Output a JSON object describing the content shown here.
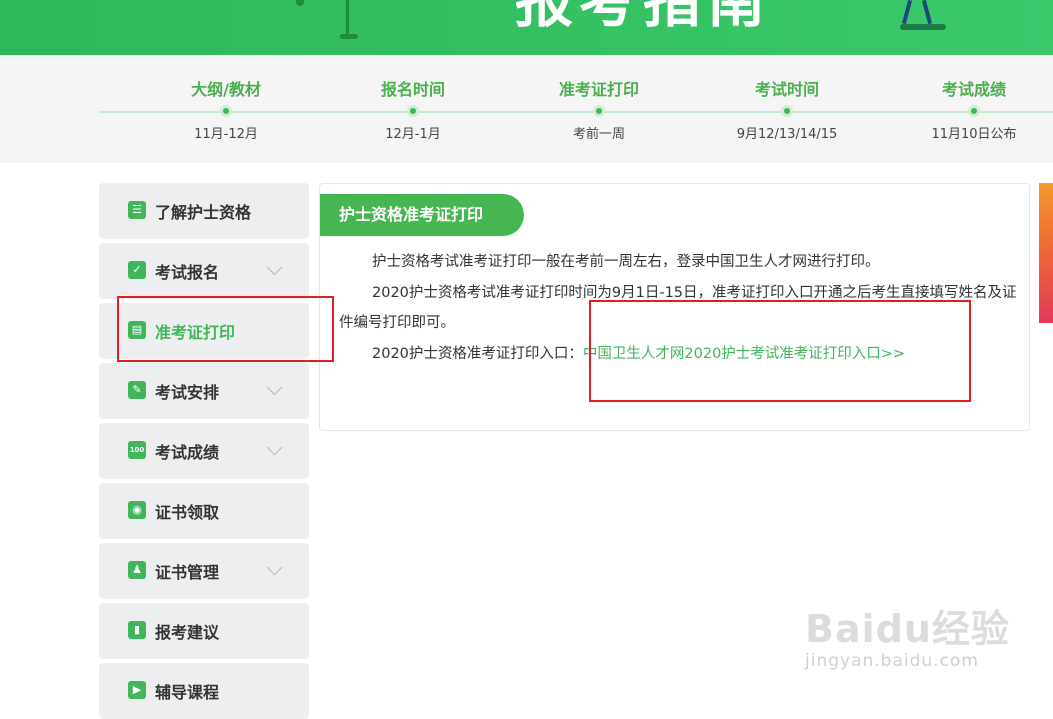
{
  "banner": {
    "title": "报考指南"
  },
  "timeline": [
    {
      "title": "大纲/教材",
      "sub": "11月-12月"
    },
    {
      "title": "报名时间",
      "sub": "12月-1月"
    },
    {
      "title": "准考证打印",
      "sub": "考前一周"
    },
    {
      "title": "考试时间",
      "sub": "9月12/13/14/15"
    },
    {
      "title": "考试成绩",
      "sub": "11月10日公布"
    }
  ],
  "sidebar": {
    "items": [
      {
        "label": "了解护士资格",
        "icon": "list-icon",
        "glyph": "☰",
        "expandable": false
      },
      {
        "label": "考试报名",
        "icon": "monitor-check-icon",
        "glyph": "✓",
        "expandable": true
      },
      {
        "label": "准考证打印",
        "icon": "id-card-icon",
        "glyph": "▤",
        "expandable": false,
        "active": true
      },
      {
        "label": "考试安排",
        "icon": "edit-icon",
        "glyph": "✎",
        "expandable": true
      },
      {
        "label": "考试成绩",
        "icon": "score-icon",
        "glyph": "100",
        "expandable": true
      },
      {
        "label": "证书领取",
        "icon": "medal-icon",
        "glyph": "◉",
        "expandable": false
      },
      {
        "label": "证书管理",
        "icon": "user-doc-icon",
        "glyph": "♟",
        "expandable": true
      },
      {
        "label": "报考建议",
        "icon": "bar-chart-icon",
        "glyph": "▮",
        "expandable": false
      },
      {
        "label": "辅导课程",
        "icon": "play-icon",
        "glyph": "▶",
        "expandable": false
      }
    ]
  },
  "content": {
    "tab_title": "护士资格准考证打印",
    "para1": "护士资格考试准考证打印一般在考前一周左右，登录中国卫生人才网进行打印。",
    "para2": "2020护士资格考试准考证打印时间为9月1日-15日，准考证打印入口开通之后考生直接填写姓名及证件编号打印即可。",
    "para3_prefix": "2020护士资格准考证打印入口：",
    "link_text": "中国卫生人才网2020护士考试准考证打印入口>>"
  },
  "watermark": {
    "main": "Baidu经验",
    "sub": "jingyan.baidu.com"
  },
  "colors": {
    "brand_green": "#3fb65a",
    "banner_green": "#34c062",
    "annotation_red": "#e02020"
  }
}
